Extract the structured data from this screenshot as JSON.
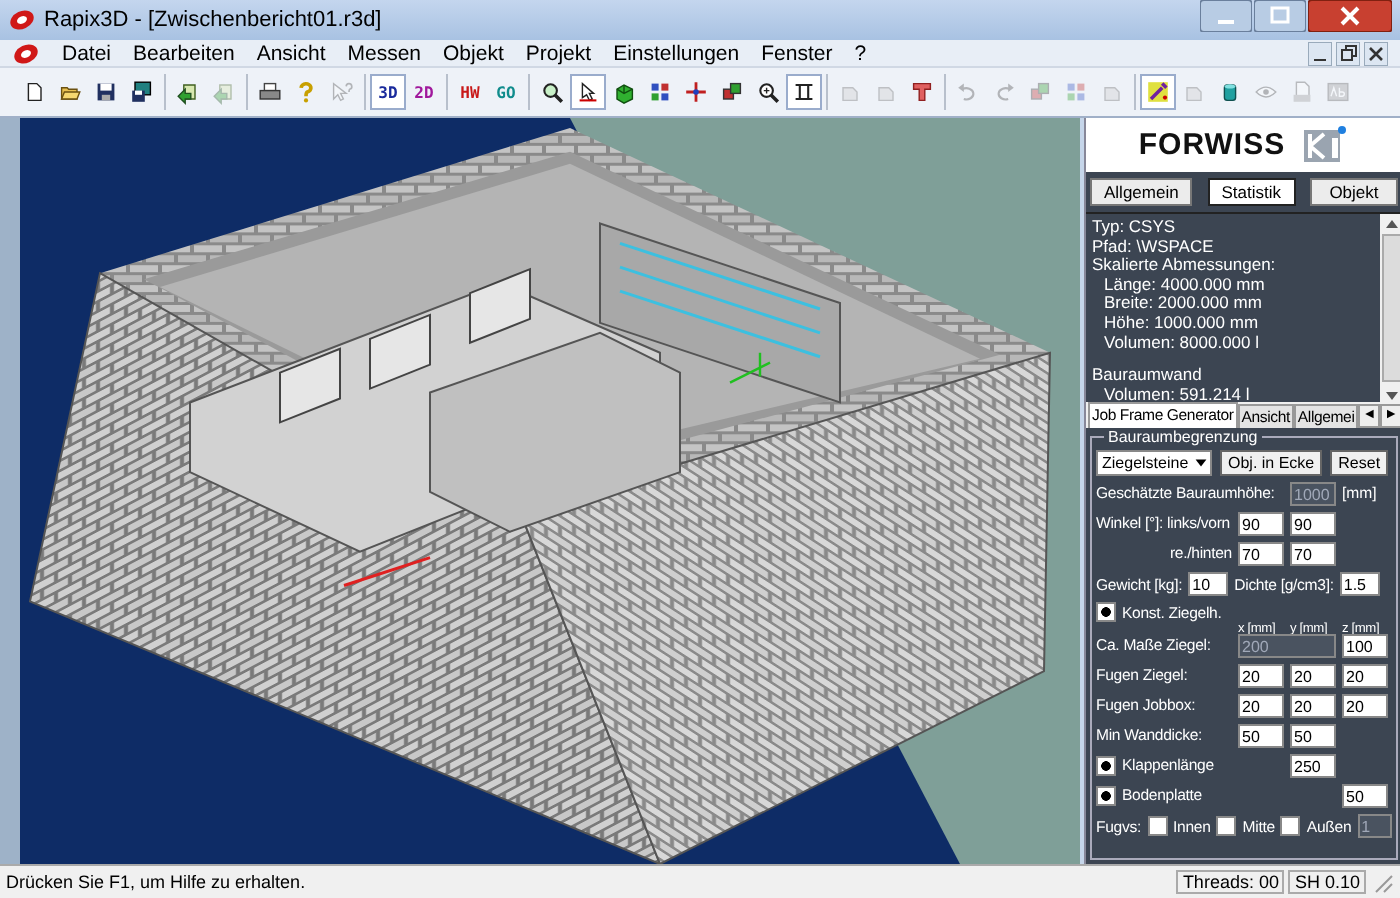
{
  "window": {
    "title": "Rapix3D - [Zwischenbericht01.r3d]"
  },
  "menu": [
    "Datei",
    "Bearbeiten",
    "Ansicht",
    "Messen",
    "Objekt",
    "Projekt",
    "Einstellungen",
    "Fenster",
    "?"
  ],
  "toolbar": [
    {
      "kind": "new",
      "disabled": false,
      "pressed": false
    },
    {
      "kind": "open",
      "disabled": false,
      "pressed": false
    },
    {
      "kind": "save",
      "disabled": false,
      "pressed": false
    },
    {
      "kind": "saveall",
      "disabled": false,
      "pressed": false
    },
    {
      "kind": "separator"
    },
    {
      "kind": "import",
      "disabled": false,
      "pressed": false
    },
    {
      "kind": "import",
      "disabled": true,
      "pressed": false
    },
    {
      "kind": "separator"
    },
    {
      "kind": "print",
      "disabled": false,
      "pressed": false
    },
    {
      "kind": "help",
      "disabled": false,
      "pressed": false
    },
    {
      "kind": "contexthelp",
      "disabled": true,
      "pressed": false
    },
    {
      "kind": "separator"
    },
    {
      "kind": "text",
      "label": "3D",
      "color": "#1a2a9c",
      "disabled": false,
      "pressed": true
    },
    {
      "kind": "text",
      "label": "2D",
      "color": "#a0189c",
      "disabled": false,
      "pressed": false
    },
    {
      "kind": "separator"
    },
    {
      "kind": "text",
      "label": "HW",
      "color": "#c81818",
      "disabled": false,
      "pressed": false
    },
    {
      "kind": "text",
      "label": "GO",
      "color": "#108c8c",
      "disabled": false,
      "pressed": false
    },
    {
      "kind": "separator"
    },
    {
      "kind": "zoom",
      "disabled": false,
      "pressed": false
    },
    {
      "kind": "select",
      "disabled": false,
      "pressed": true
    },
    {
      "kind": "cube",
      "disabled": false,
      "pressed": false
    },
    {
      "kind": "grid",
      "disabled": false,
      "pressed": false
    },
    {
      "kind": "move",
      "disabled": false,
      "pressed": false
    },
    {
      "kind": "blocks",
      "disabled": false,
      "pressed": false
    },
    {
      "kind": "zoomin",
      "disabled": false,
      "pressed": false
    },
    {
      "kind": "measure",
      "disabled": false,
      "pressed": true
    },
    {
      "kind": "separator"
    },
    {
      "kind": "shape",
      "disabled": true,
      "pressed": false
    },
    {
      "kind": "shape",
      "disabled": true,
      "pressed": false
    },
    {
      "kind": "tbar",
      "disabled": false,
      "pressed": false
    },
    {
      "kind": "separator"
    },
    {
      "kind": "undo",
      "disabled": true,
      "pressed": false
    },
    {
      "kind": "redo",
      "disabled": true,
      "pressed": false
    },
    {
      "kind": "blocks",
      "disabled": true,
      "pressed": false
    },
    {
      "kind": "grid",
      "disabled": true,
      "pressed": false
    },
    {
      "kind": "shape",
      "disabled": true,
      "pressed": false
    },
    {
      "kind": "separator"
    },
    {
      "kind": "tools",
      "disabled": false,
      "pressed": true
    },
    {
      "kind": "shape",
      "disabled": true,
      "pressed": false
    },
    {
      "kind": "cylinder",
      "disabled": false,
      "pressed": false
    },
    {
      "kind": "eye",
      "disabled": true,
      "pressed": false
    },
    {
      "kind": "document",
      "disabled": true,
      "pressed": false
    },
    {
      "kind": "abc",
      "disabled": true,
      "pressed": false
    }
  ],
  "panel": {
    "logo": "FORWISS",
    "buttons": [
      {
        "label": "Allgemein",
        "selected": false
      },
      {
        "label": "Statistik",
        "selected": true
      },
      {
        "label": "Objekt",
        "selected": false
      }
    ],
    "info": [
      [
        {
          "text": "Typ: CSYS",
          "indented": false
        },
        {
          "text": "Pfad: \\WSPACE",
          "indented": false
        },
        {
          "text": "Skalierte Abmessungen:",
          "indented": false
        },
        {
          "text": "Länge: 4000.000 mm",
          "indented": true
        },
        {
          "text": "Breite: 2000.000 mm",
          "indented": true
        },
        {
          "text": "Höhe: 1000.000 mm",
          "indented": true
        },
        {
          "text": "Volumen: 8000.000 l",
          "indented": true
        }
      ],
      [
        {
          "text": "Bauraumwand",
          "indented": false
        },
        {
          "text": "Volumen: 591.214 l",
          "indented": true
        }
      ]
    ],
    "tabs": [
      {
        "label": "Job Frame Generator",
        "selected": true
      },
      {
        "label": "Ansicht",
        "selected": false
      },
      {
        "label": "Allgemei",
        "selected": false
      }
    ],
    "tab_scroll": [
      "◄",
      "►"
    ],
    "group_title": "Bauraumbegrenzung",
    "material": "Ziegelsteine",
    "corner_button": "Obj. in Ecke",
    "reset_button": "Reset",
    "rows": [
      {
        "kind": "fields",
        "label": "Geschätzte Bauraumhöhe:",
        "fields": {
          "y": {
            "value": "1000",
            "disabled": true
          }
        },
        "unit": "[mm]"
      },
      {
        "kind": "fields",
        "label": "Winkel [°]: links/vorn",
        "fields": {
          "x": {
            "value": "90",
            "disabled": false
          },
          "y": {
            "value": "90",
            "disabled": false
          }
        }
      },
      {
        "kind": "continuation",
        "label": "re./hinten",
        "fields": {
          "x": {
            "value": "70",
            "disabled": false
          },
          "y": {
            "value": "70",
            "disabled": false
          }
        }
      },
      {
        "kind": "pair",
        "label": "Gewicht [kg]:",
        "value": "10",
        "label_2": "Dichte [g/cm3]:",
        "value_2": "1.5"
      },
      {
        "kind": "header",
        "label": "Konst. Ziegelh.",
        "checked": true,
        "columns": [
          "x [mm]",
          "y [mm]",
          "z [mm]"
        ]
      },
      {
        "kind": "fields",
        "label": "Ca. Maße Ziegel:",
        "fields": {
          "xy": {
            "value": "200",
            "disabled": true
          },
          "z": {
            "value": "100",
            "disabled": false
          }
        }
      },
      {
        "kind": "fields",
        "label": "Fugen Ziegel:",
        "fields": {
          "x": {
            "value": "20",
            "disabled": false
          },
          "y": {
            "value": "20",
            "disabled": false
          },
          "z": {
            "value": "20",
            "disabled": false
          }
        }
      },
      {
        "kind": "fields",
        "label": "Fugen Jobbox:",
        "fields": {
          "x": {
            "value": "20",
            "disabled": false
          },
          "y": {
            "value": "20",
            "disabled": false
          },
          "z": {
            "value": "20",
            "disabled": false
          }
        }
      },
      {
        "kind": "fields",
        "label": "Min Wanddicke:",
        "fields": {
          "x": {
            "value": "50",
            "disabled": false
          },
          "y": {
            "value": "50",
            "disabled": false
          }
        }
      },
      {
        "kind": "checkfields",
        "label": "Klappenlänge",
        "checked": true,
        "fields": {
          "y": {
            "value": "250",
            "disabled": false
          }
        }
      },
      {
        "kind": "checkfields",
        "label": "Bodenplatte",
        "checked": true,
        "fields": {
          "z": {
            "value": "50",
            "disabled": false
          }
        }
      },
      {
        "kind": "options",
        "label": "Fugvs:",
        "options": [
          {
            "label": "Innen",
            "checked": false
          },
          {
            "label": "Mitte",
            "checked": false
          },
          {
            "label": "Außen",
            "checked": false
          }
        ],
        "value": "1",
        "disabled": true
      }
    ]
  },
  "status_bar": {
    "message": "Drücken Sie F1, um Hilfe zu erhalten.",
    "panes": [
      "Threads: 00",
      "SH 0.10"
    ]
  }
}
